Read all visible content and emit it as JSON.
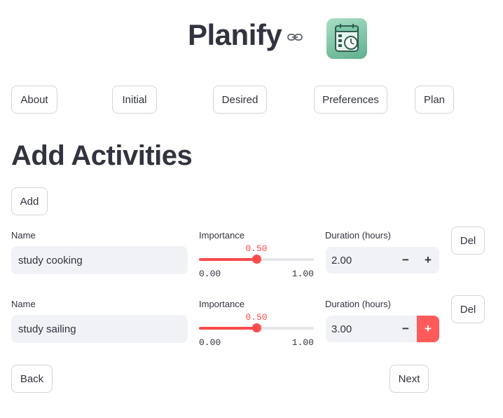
{
  "header": {
    "title": "Planify",
    "link_icon": "link-icon",
    "logo_icon": "calendar-clock-icon"
  },
  "nav": {
    "about": "About",
    "initial": "Initial",
    "desired": "Desired",
    "preferences": "Preferences",
    "plan": "Plan"
  },
  "section_title": "Add Activities",
  "add_label": "Add",
  "activities": [
    {
      "name_label": "Name",
      "name_value": "study cooking",
      "importance_label": "Importance",
      "importance_value": 0.5,
      "importance_display": "0.50",
      "importance_min": "0.00",
      "importance_max": "1.00",
      "duration_label": "Duration (hours)",
      "duration_value": "2.00",
      "minus": "−",
      "plus": "+",
      "del_label": "Del"
    },
    {
      "name_label": "Name",
      "name_value": "study sailing",
      "importance_label": "Importance",
      "importance_value": 0.5,
      "importance_display": "0.50",
      "importance_min": "0.00",
      "importance_max": "1.00",
      "duration_label": "Duration (hours)",
      "duration_value": "3.00",
      "minus": "−",
      "plus": "+",
      "del_label": "Del"
    }
  ],
  "footer": {
    "back": "Back",
    "next": "Next"
  },
  "colors": {
    "accent": "#ff4b4b",
    "input_bg": "#f0f2f6",
    "text": "#31333f"
  }
}
